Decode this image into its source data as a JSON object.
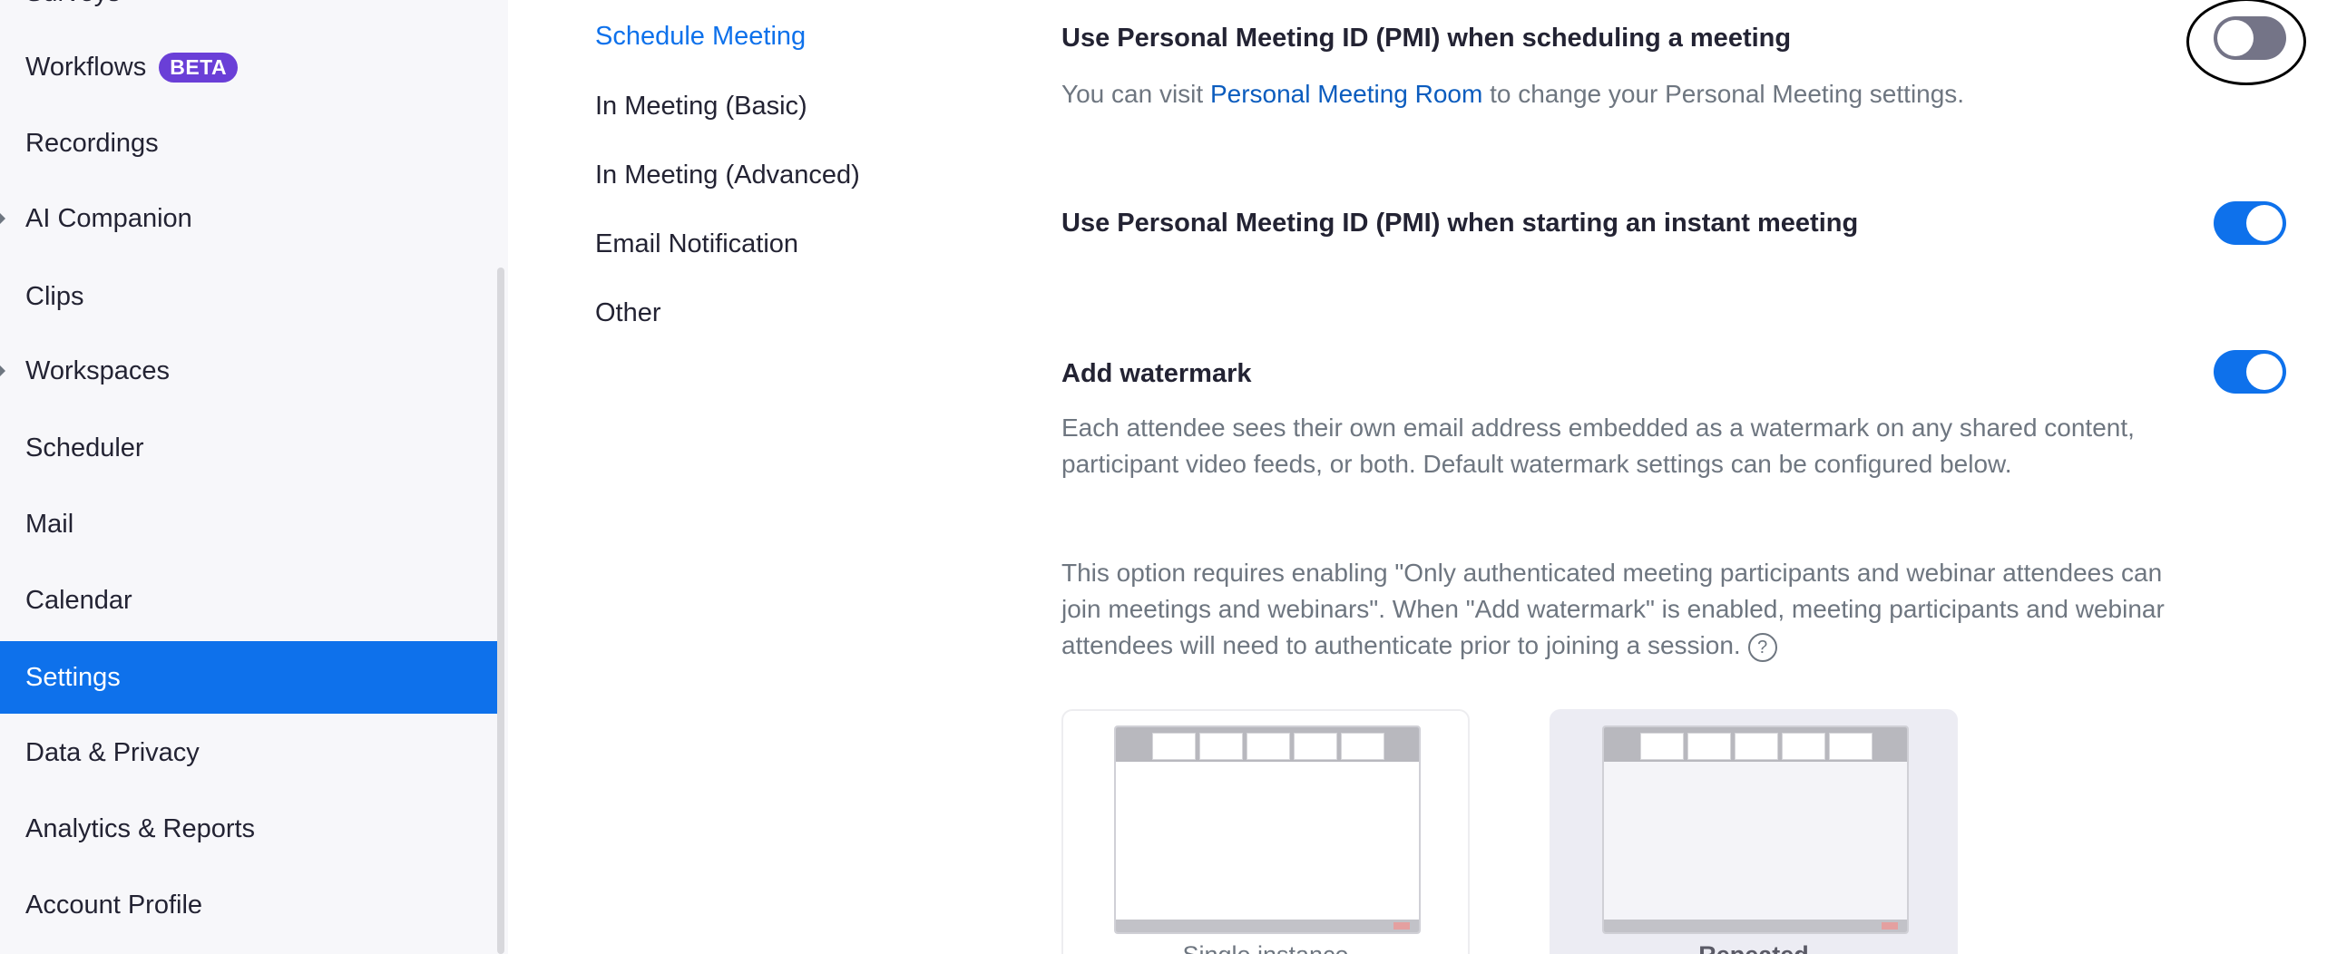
{
  "sidebar": {
    "items": [
      {
        "label": "Surveys",
        "badge": "",
        "arrow": false,
        "active": false
      },
      {
        "label": "Workflows",
        "badge": "BETA",
        "arrow": false,
        "active": false
      },
      {
        "label": "Recordings",
        "badge": "",
        "arrow": false,
        "active": false
      },
      {
        "label": "AI Companion",
        "badge": "",
        "arrow": true,
        "active": false
      },
      {
        "label": "Clips",
        "badge": "",
        "arrow": false,
        "active": false
      },
      {
        "label": "Workspaces",
        "badge": "",
        "arrow": true,
        "active": false
      },
      {
        "label": "Scheduler",
        "badge": "",
        "arrow": false,
        "active": false
      },
      {
        "label": "Mail",
        "badge": "",
        "arrow": false,
        "active": false
      },
      {
        "label": "Calendar",
        "badge": "",
        "arrow": false,
        "active": false
      },
      {
        "label": "Settings",
        "badge": "",
        "arrow": false,
        "active": true
      },
      {
        "label": "Data & Privacy",
        "badge": "",
        "arrow": false,
        "active": false
      },
      {
        "label": "Analytics & Reports",
        "badge": "",
        "arrow": false,
        "active": false
      },
      {
        "label": "Account Profile",
        "badge": "",
        "arrow": false,
        "active": false
      }
    ]
  },
  "section_nav": {
    "items": [
      {
        "label": "Schedule Meeting",
        "active": true
      },
      {
        "label": "In Meeting (Basic)",
        "active": false
      },
      {
        "label": "In Meeting (Advanced)",
        "active": false
      },
      {
        "label": "Email Notification",
        "active": false
      },
      {
        "label": "Other",
        "active": false
      }
    ]
  },
  "settings": {
    "pmi_schedule": {
      "title": "Use Personal Meeting ID (PMI) when scheduling a meeting",
      "desc_prefix": "You can visit ",
      "desc_link": "Personal Meeting Room",
      "desc_suffix": " to change your Personal Meeting settings.",
      "enabled": false
    },
    "pmi_instant": {
      "title": "Use Personal Meeting ID (PMI) when starting an instant meeting",
      "enabled": true
    },
    "watermark": {
      "title": "Add watermark",
      "desc1": "Each attendee sees their own email address embedded as a watermark on any shared content, participant video feeds, or both. Default watermark settings can be configured below.",
      "desc2": "This option requires enabling \"Only authenticated meeting participants and webinar attendees can join meetings and webinars\". When \"Add watermark\" is enabled, meeting participants and webinar attendees will need to authenticate prior to joining a session.",
      "help_icon": "?",
      "enabled": true,
      "options": [
        {
          "label": "Single instance",
          "selected": false
        },
        {
          "label": "Repeated",
          "selected": true
        }
      ]
    }
  },
  "colors": {
    "accent": "#0e71eb",
    "toggle_off": "#747487",
    "beta_badge": "#6a3fd7",
    "link": "#0b5cbe"
  }
}
